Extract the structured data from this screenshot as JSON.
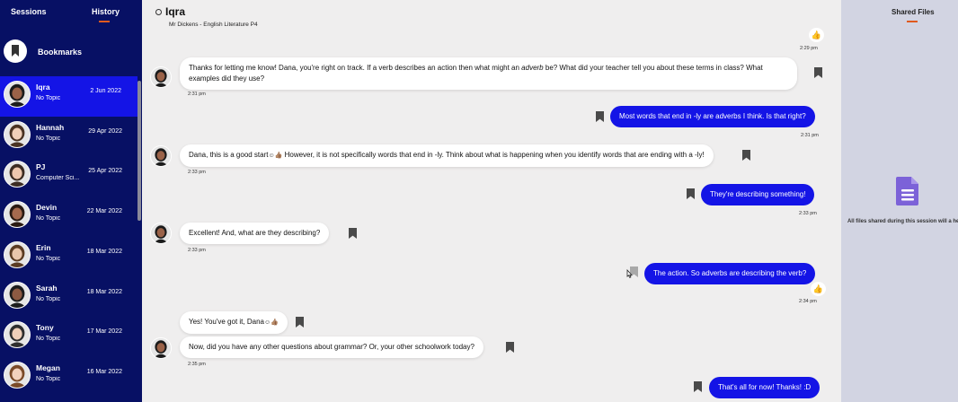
{
  "sidebar": {
    "tabs": [
      {
        "label": "Sessions"
      },
      {
        "label": "History",
        "active": true
      }
    ],
    "bookmarks_label": "Bookmarks",
    "conversations": [
      {
        "name": "Iqra",
        "topic": "No Topic",
        "date": "2 Jun 2022",
        "active": true,
        "skin": "#9a6248",
        "hair": "#1b1b1b"
      },
      {
        "name": "Hannah",
        "topic": "No Topic",
        "date": "29 Apr 2022",
        "skin": "#f0cfb8",
        "hair": "#4a3322"
      },
      {
        "name": "PJ",
        "topic": "Computer Sci...",
        "date": "25 Apr 2022",
        "skin": "#eec7ae",
        "hair": "#3c2c22"
      },
      {
        "name": "Devin",
        "topic": "No Topic",
        "date": "22 Mar 2022",
        "skin": "#a66a4e",
        "hair": "#2a1a12"
      },
      {
        "name": "Erin",
        "topic": "No Topic",
        "date": "18 Mar 2022",
        "skin": "#e9c5aa",
        "hair": "#5a3b22"
      },
      {
        "name": "Sarah",
        "topic": "No Topic",
        "date": "18 Mar 2022",
        "skin": "#8d5a42",
        "hair": "#1c1c1c"
      },
      {
        "name": "Tony",
        "topic": "No Topic",
        "date": "17 Mar 2022",
        "skin": "#efcfb9",
        "hair": "#2e2e2e"
      },
      {
        "name": "Megan",
        "topic": "No Topic",
        "date": "16 Mar 2022",
        "skin": "#f2d1bd",
        "hair": "#7a4a28"
      }
    ]
  },
  "chat": {
    "name": "Iqra",
    "subtitle": "Mr Dickens - English Literature P4",
    "messages": [
      {
        "from": "mentor",
        "time": "2:31 pm",
        "parts": [
          "Thanks for letting me know! Dana, you're right on track. If a verb describes an action then what might an ",
          "adverb",
          " be? What did your teacher tell you about these terms in class? What examples did they use?"
        ]
      },
      {
        "from": "student",
        "time": "2:31 pm",
        "text": "Most words that end in -ly are adverbs I think. Is that right?"
      },
      {
        "from": "mentor",
        "time": "2:33 pm",
        "text": "Dana, this is a good start",
        "text2": " However, it is not specifically words that end in -ly. Think about what is happening when you identify words that are ending with a -ly!"
      },
      {
        "from": "student",
        "time": "2:33 pm",
        "text": "They're describing something!"
      },
      {
        "from": "mentor",
        "time": "2:33 pm",
        "text": "Excellent! And, what are they describing?"
      },
      {
        "from": "student",
        "time": "2:34 pm",
        "text": "The action. So adverbs are describing the verb?"
      },
      {
        "from": "mentor",
        "text": "Yes! You've got it, Dana"
      },
      {
        "from": "mentor",
        "time": "2:35 pm",
        "text": "Now, did you have any other questions about grammar? Or, your other schoolwork today?"
      },
      {
        "from": "student",
        "text": "That's all for now! Thanks! :D"
      }
    ],
    "top_time": "2:29 pm",
    "emoji": {
      "thumbs_up": "👍",
      "smile": "☺",
      "thumbs_up_tone": "👍🏽"
    }
  },
  "files": {
    "title": "Shared Files",
    "empty_message": "All files shared during this session will a here",
    "icon": "document-icon",
    "accent": "#7c62d8"
  },
  "colors": {
    "sidebar_bg": "#071064",
    "active_blue": "#1414e6",
    "accent_orange": "#e05a1e",
    "chat_bg": "#efeeee",
    "files_bg": "#d2d4e2"
  }
}
